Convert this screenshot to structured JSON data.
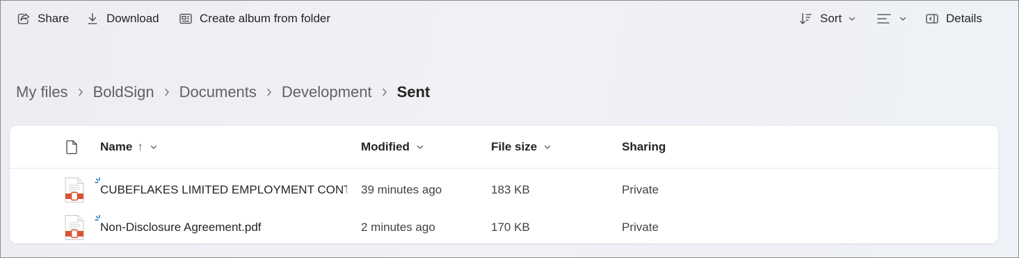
{
  "toolbar": {
    "share_label": "Share",
    "download_label": "Download",
    "create_album_label": "Create album from folder",
    "sort_label": "Sort",
    "details_label": "Details"
  },
  "breadcrumb": [
    "My files",
    "BoldSign",
    "Documents",
    "Development",
    "Sent"
  ],
  "columns": {
    "name": "Name",
    "name_sort_indicator": "↑",
    "modified": "Modified",
    "file_size": "File size",
    "sharing": "Sharing"
  },
  "files": [
    {
      "name": "CUBEFLAKES LIMITED EMPLOYMENT CONT...",
      "modified": "39 minutes ago",
      "size": "183 KB",
      "sharing": "Private",
      "icon": "pdf-file-icon"
    },
    {
      "name": "Non-Disclosure Agreement.pdf",
      "modified": "2 minutes ago",
      "size": "170 KB",
      "sharing": "Private",
      "icon": "pdf-file-icon"
    }
  ],
  "colors": {
    "pdf_red": "#d65532",
    "new_indicator": "#0f6cbd",
    "text_primary": "#242424",
    "text_secondary": "#616161"
  }
}
